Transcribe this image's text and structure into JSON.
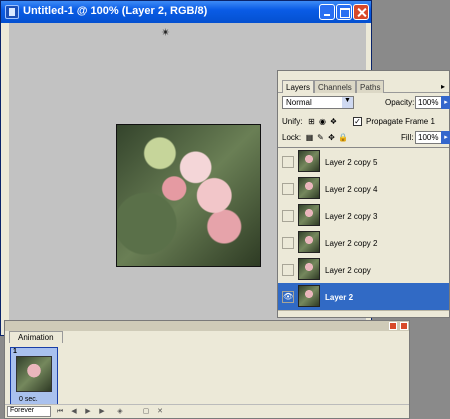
{
  "document": {
    "title": "Untitled-1 @ 100% (Layer 2, RGB/8)"
  },
  "layers_panel": {
    "tabs": [
      "Layers",
      "Channels",
      "Paths"
    ],
    "blend_mode": "Normal",
    "opacity_label": "Opacity:",
    "opacity_value": "100%",
    "unify_label": "Unify:",
    "propagate_label": "Propagate Frame 1",
    "lock_label": "Lock:",
    "fill_label": "Fill:",
    "fill_value": "100%",
    "layers": [
      {
        "name": "Layer 2 copy 5",
        "visible": false,
        "selected": false
      },
      {
        "name": "Layer 2 copy 4",
        "visible": false,
        "selected": false
      },
      {
        "name": "Layer 2 copy 3",
        "visible": false,
        "selected": false
      },
      {
        "name": "Layer 2 copy 2",
        "visible": false,
        "selected": false
      },
      {
        "name": "Layer 2 copy",
        "visible": false,
        "selected": false
      },
      {
        "name": "Layer 2",
        "visible": true,
        "selected": true
      }
    ]
  },
  "animation_panel": {
    "tab_label": "Animation",
    "frame_number": "1",
    "frame_delay": "0 sec.",
    "loop_option": "Forever"
  },
  "icons": {
    "eye": "👁",
    "check": "✓",
    "magic_wand": "✴"
  }
}
